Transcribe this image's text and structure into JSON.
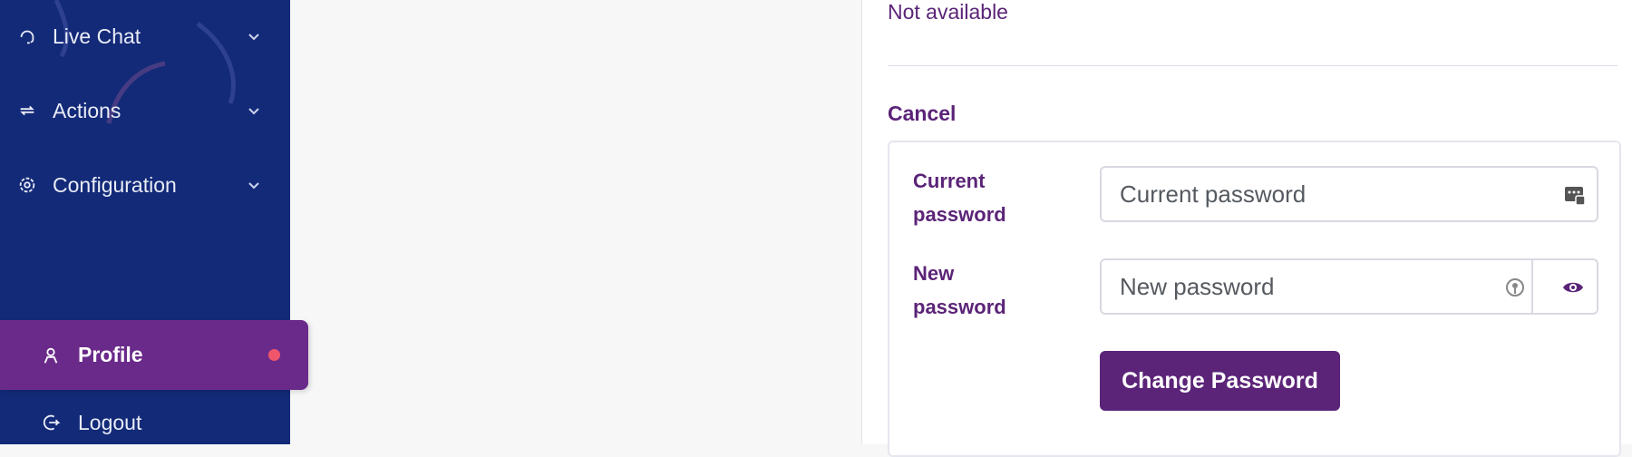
{
  "sidebar": {
    "items": [
      {
        "label": "Live Chat",
        "icon": "headset-icon"
      },
      {
        "label": "Actions",
        "icon": "repeat-icon"
      },
      {
        "label": "Configuration",
        "icon": "gear-icon"
      }
    ],
    "profile": {
      "label": "Profile",
      "icon": "user-icon"
    },
    "logout": {
      "label": "Logout",
      "icon": "logout-icon"
    }
  },
  "panel": {
    "status_text": "Not available",
    "cancel_label": "Cancel",
    "form": {
      "current_password_label": "Current password",
      "current_password_placeholder": "Current password",
      "new_password_label": "New password",
      "new_password_placeholder": "New password",
      "submit_label": "Change Password"
    }
  },
  "colors": {
    "sidebar_bg": "#132a78",
    "accent": "#5b2478",
    "profile_active_bg": "#6a2a8a",
    "notification_dot": "#f0566b"
  }
}
